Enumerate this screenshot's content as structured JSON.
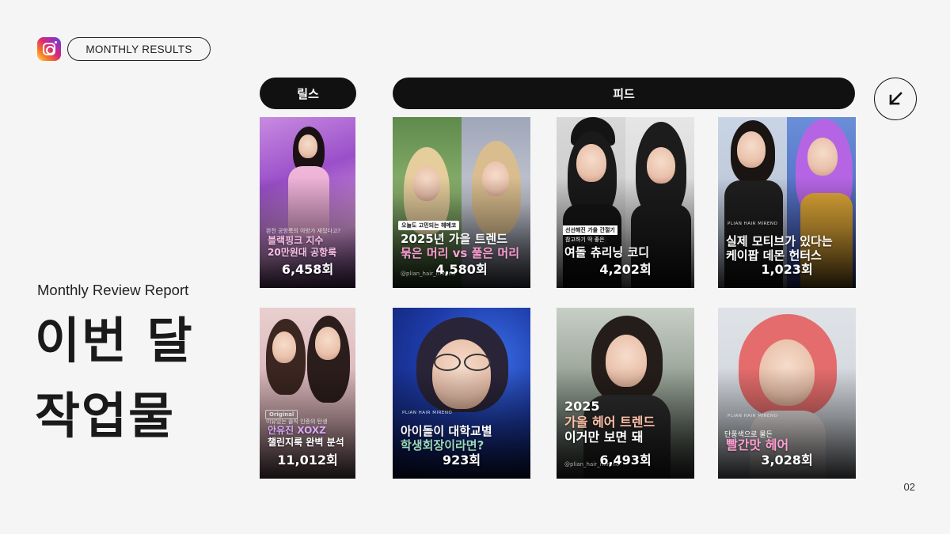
{
  "header": {
    "label": "MONTHLY RESULTS",
    "logo_icon": "instagram-icon"
  },
  "left": {
    "subtitle": "Monthly Review Report",
    "title_line1": "이번 달",
    "title_line2": "작업물"
  },
  "categories": {
    "reels": "릴스",
    "feed": "피드"
  },
  "nav": {
    "icon": "arrow-down-left-icon"
  },
  "cards": [
    {
      "section": "reels",
      "small": "완전 공항룩의 아방가 재밌다고?",
      "line1": "블랙핑크 지수",
      "line2": "20만원대 공항룩",
      "count": "6,458회"
    },
    {
      "section": "feed",
      "tag": "오늘도 고민되는 헤메코",
      "line1": "2025년 가을 트렌드",
      "line2": "묶은 머리 vs 풀은 머리",
      "handle": "@plian_hair_mireno",
      "count": "4,580회"
    },
    {
      "section": "feed",
      "small_a": "선선해진 가을 간절기",
      "small_b": "참고하기 딱 좋은",
      "line1": "여돌 츄리닝 코디",
      "count": "4,202회"
    },
    {
      "section": "feed",
      "brand": "PLIAN HAIR MIRENO",
      "line1": "실제 모티브가 있다는",
      "line2": "케이팝 데몬 헌터스",
      "count": "1,023회"
    },
    {
      "section": "reels",
      "tag": "Original",
      "small": "이유있는 솔직 인증의 탄생",
      "line1": "안유진 XOXZ",
      "line2": "챌린지룩 완벽 분석",
      "count": "11,012회"
    },
    {
      "section": "feed",
      "brand": "PLIAN HAIR MIRENO",
      "line1": "아이돌이 대학교별",
      "line2": "학생회장이라면?",
      "count": "923회"
    },
    {
      "section": "feed",
      "line0": "2025",
      "line1": "가을 헤어 트렌드",
      "line2": "이거만 보면 돼",
      "handle": "@plian_hair_mireno",
      "count": "6,493회"
    },
    {
      "section": "feed",
      "brand": "PLIAN HAIR MIRENO",
      "small": "단풍색으로 물든",
      "line1": "빨간맛 헤어",
      "count": "3,028회"
    }
  ],
  "footer": {
    "page_number": "02"
  }
}
